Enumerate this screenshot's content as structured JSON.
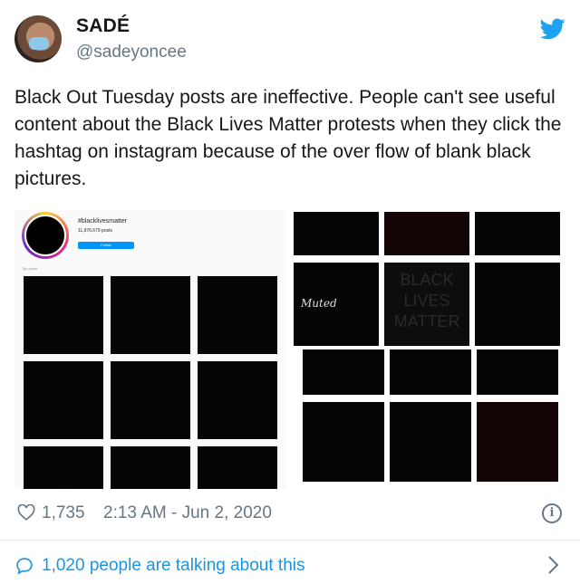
{
  "author": {
    "display_name": "SADÉ",
    "handle": "@sadeyoncee"
  },
  "tweet": {
    "text": "Black Out Tuesday posts are ineffective. People can't see useful content about the Black Lives Matter protests when they click the hashtag on instagram because of the over flow of blank black pictures."
  },
  "media": {
    "left": {
      "hashtag": "#blacklivesmatter",
      "post_count": "11,976,679 posts",
      "follow_label": "Follow",
      "section_label": "Top posts"
    },
    "right": {
      "overlay_text": "BLACK LIVES MATTER",
      "script_text": "Muted"
    }
  },
  "meta": {
    "likes": "1,735",
    "timestamp": "2:13 AM - Jun 2, 2020"
  },
  "footer": {
    "talking": "1,020 people are talking about this"
  },
  "colors": {
    "link": "#1b95e0",
    "secondary": "#657786",
    "twitter_blue": "#1da1f2"
  },
  "icons": [
    "twitter-bird-icon",
    "heart-icon",
    "info-icon",
    "comment-bubble-icon",
    "chevron-right-icon"
  ]
}
